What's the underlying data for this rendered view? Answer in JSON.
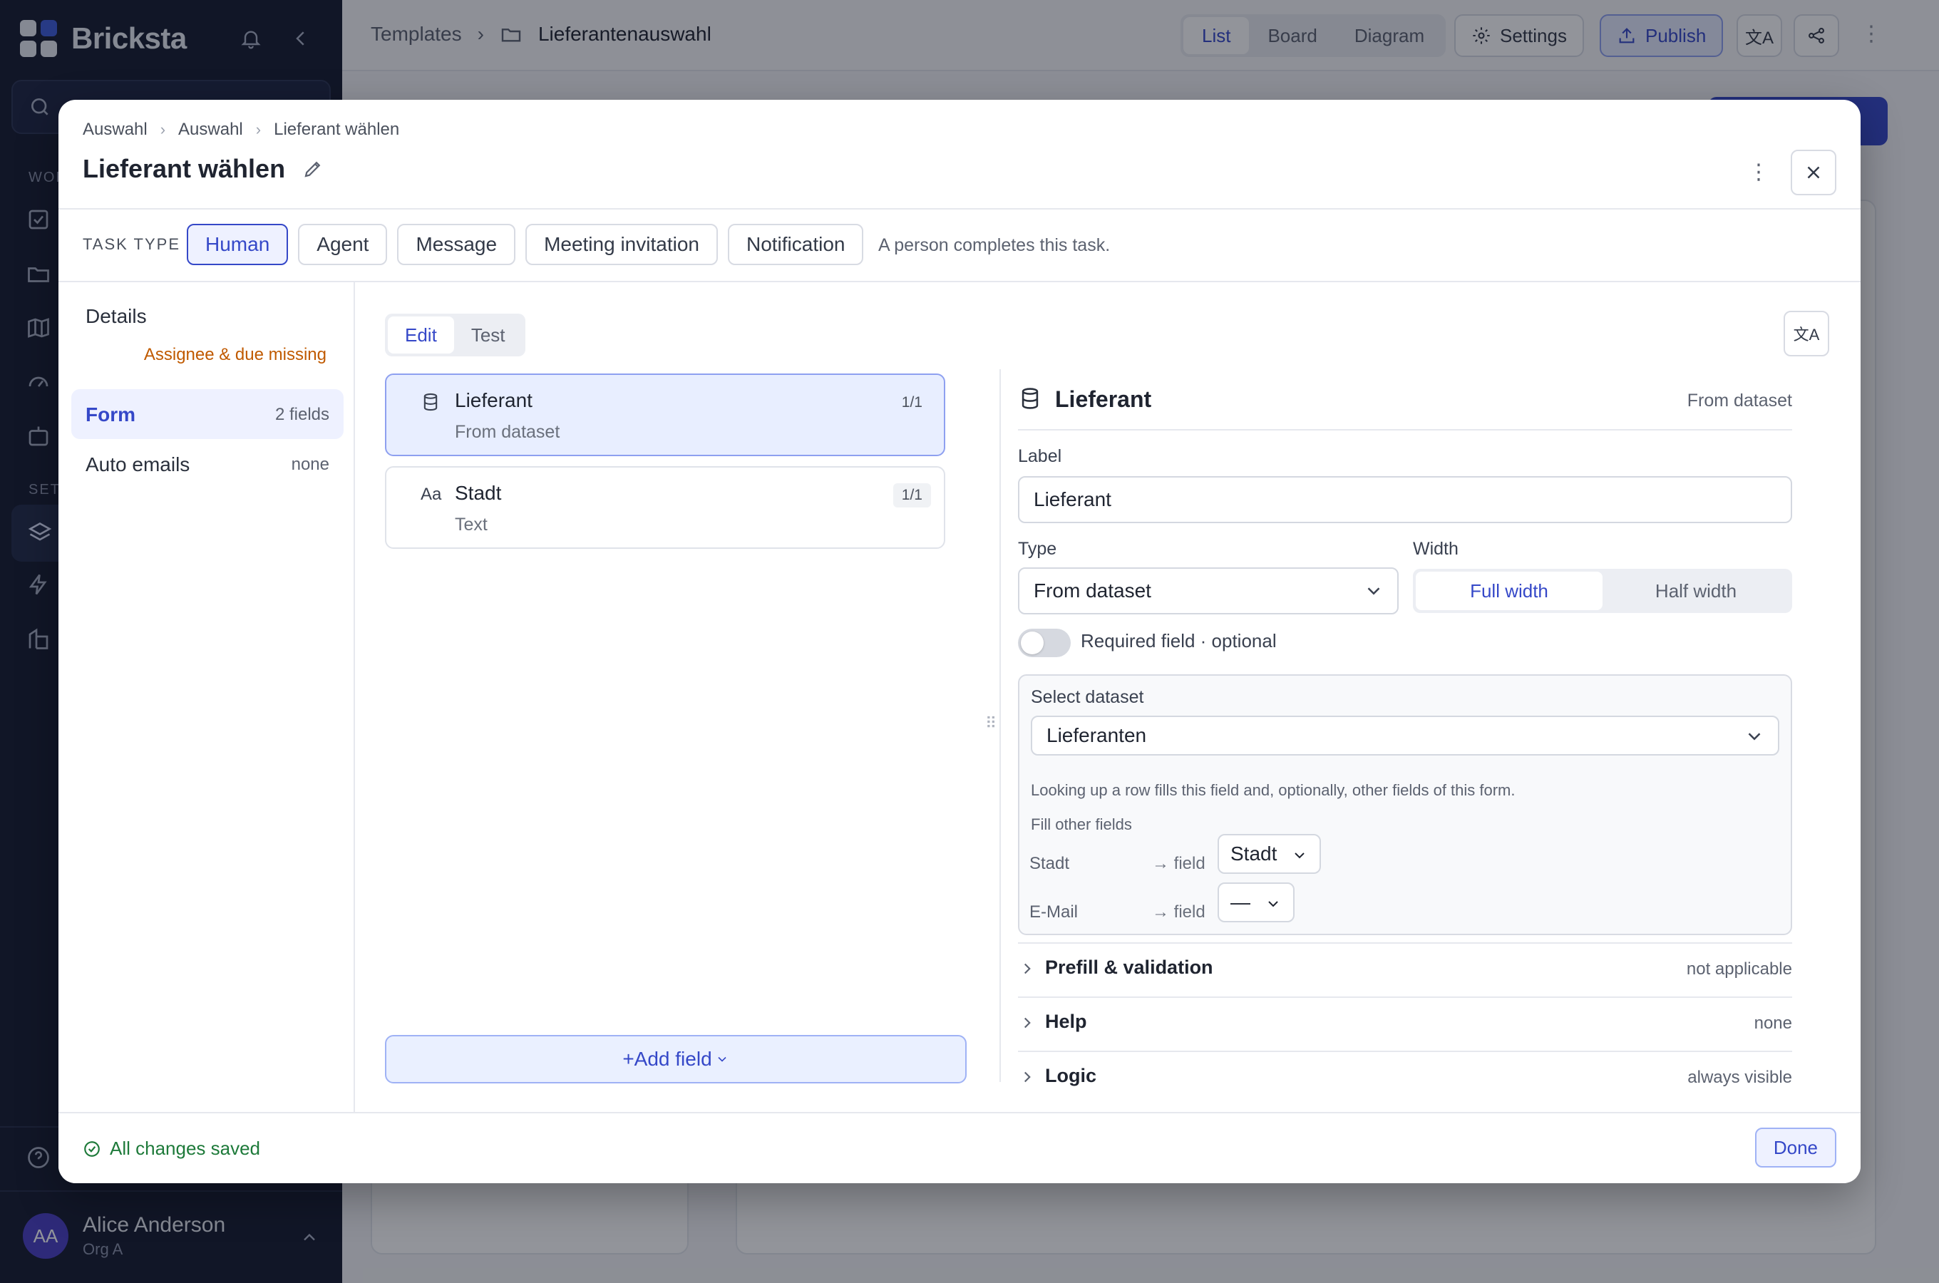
{
  "app": {
    "name": "Bricksta"
  },
  "topbar": {
    "crumb_templates": "Templates",
    "crumb_current": "Lieferantenauswahl",
    "views": [
      "List",
      "Board",
      "Diagram"
    ],
    "active_view": "List",
    "settings_label": "Settings",
    "publish_label": "Publish"
  },
  "sidebar": {
    "section_work": "WOR",
    "section_setup": "SETU"
  },
  "user": {
    "initials": "AA",
    "name": "Alice Anderson",
    "org": "Org A"
  },
  "modal": {
    "breadcrumbs": [
      "Auswahl",
      "Auswahl",
      "Lieferant wählen"
    ],
    "title": "Lieferant wählen",
    "task_type_label": "TASK TYPE",
    "task_types": [
      "Human",
      "Agent",
      "Message",
      "Meeting invitation",
      "Notification"
    ],
    "selected_task_type": "Human",
    "task_type_description": "A person completes this task.",
    "nav": {
      "details": "Details",
      "details_warning": "Assignee & due missing",
      "form": "Form",
      "form_meta": "2 fields",
      "auto_emails": "Auto emails",
      "auto_emails_meta": "none"
    },
    "mode_tabs": [
      "Edit",
      "Test"
    ],
    "active_mode": "Edit",
    "fields": [
      {
        "name": "Lieferant",
        "type": "From dataset",
        "badge": "1/1"
      },
      {
        "name": "Stadt",
        "type": "Text",
        "badge": "1/1"
      }
    ],
    "add_field_label": "+Add field",
    "editor": {
      "title": "Lieferant",
      "type_label": "From dataset",
      "label_caption": "Label",
      "label_value": "Lieferant",
      "type_caption": "Type",
      "type_value": "From dataset",
      "width_caption": "Width",
      "width_options": [
        "Full width",
        "Half width"
      ],
      "width_selected": "Full width",
      "required_label": "Required field · optional",
      "required_on": false,
      "dataset_caption": "Select dataset",
      "dataset_value": "Lieferanten",
      "dataset_note": "Looking up a row fills this field and, optionally, other fields of this form.",
      "fill_other_label": "Fill other fields",
      "mappings": [
        {
          "source": "Stadt",
          "arrow": "→ field",
          "target": "Stadt"
        },
        {
          "source": "E-Mail",
          "arrow": "→ field",
          "target": "—"
        }
      ],
      "sections": [
        {
          "title": "Prefill & validation",
          "meta": "not applicable"
        },
        {
          "title": "Help",
          "meta": "none"
        },
        {
          "title": "Logic",
          "meta": "always visible"
        }
      ]
    },
    "footer": {
      "status": "All changes saved",
      "done_label": "Done"
    }
  },
  "colors": {
    "accent": "#3548c8",
    "sidebar": "#141a2e",
    "success": "#1e7a3a",
    "warning": "#c05a00"
  }
}
